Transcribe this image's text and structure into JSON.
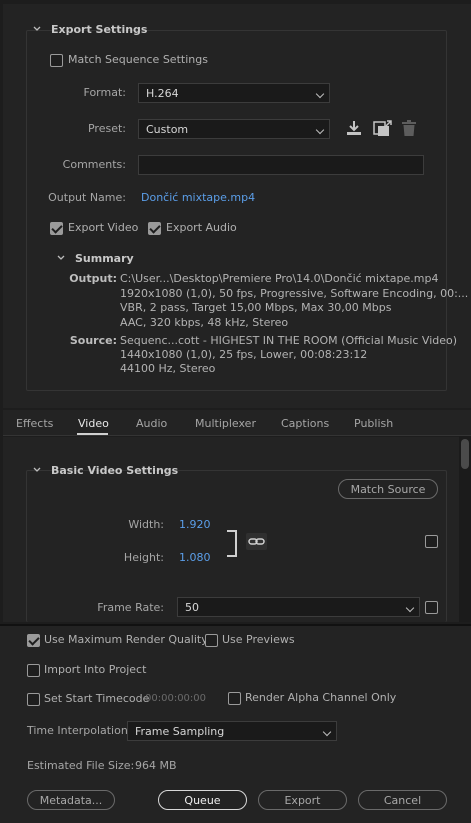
{
  "export_settings": {
    "header": "Export Settings",
    "match_sequence": {
      "label": "Match Sequence Settings",
      "checked": false
    },
    "format": {
      "label": "Format:",
      "value": "H.264"
    },
    "preset": {
      "label": "Preset:",
      "value": "Custom"
    },
    "comments": {
      "label": "Comments:",
      "value": ""
    },
    "output_name": {
      "label": "Output Name:",
      "value": "Dončić mixtape.mp4"
    },
    "export_video": {
      "label": "Export Video",
      "checked": true
    },
    "export_audio": {
      "label": "Export Audio",
      "checked": true
    },
    "summary": {
      "header": "Summary",
      "output_key": "Output:",
      "output_lines": [
        "C:\\User...\\Desktop\\Premiere Pro\\14.0\\Dončić mixtape.mp4",
        "1920x1080 (1,0), 50 fps, Progressive, Software Encoding, 00:...",
        "VBR, 2 pass, Target 15,00 Mbps, Max 30,00 Mbps",
        "AAC, 320 kbps, 48 kHz, Stereo"
      ],
      "source_key": "Source:",
      "source_lines": [
        "Sequenc...cott - HIGHEST IN THE ROOM (Official Music Video)",
        "1440x1080 (1,0), 25 fps, Lower, 00:08:23:12",
        "44100 Hz, Stereo"
      ]
    }
  },
  "tabs": [
    {
      "label": "Effects",
      "active": false
    },
    {
      "label": "Video",
      "active": true
    },
    {
      "label": "Audio",
      "active": false
    },
    {
      "label": "Multiplexer",
      "active": false
    },
    {
      "label": "Captions",
      "active": false
    },
    {
      "label": "Publish",
      "active": false
    }
  ],
  "video": {
    "header": "Basic Video Settings",
    "match_source_label": "Match Source",
    "width": {
      "label": "Width:",
      "value": "1.920"
    },
    "height": {
      "label": "Height:",
      "value": "1.080"
    },
    "frame_rate": {
      "label": "Frame Rate:",
      "value": "50"
    }
  },
  "bottom": {
    "use_max_render_quality": {
      "label": "Use Maximum Render Quality",
      "checked": true
    },
    "use_previews": {
      "label": "Use Previews",
      "checked": false
    },
    "import_into_project": {
      "label": "Import Into Project",
      "checked": false
    },
    "set_start_timecode": {
      "label": "Set Start Timecode",
      "checked": false,
      "timecode": "00:00:00:00"
    },
    "render_alpha": {
      "label": "Render Alpha Channel Only",
      "checked": false
    },
    "time_interpolation": {
      "label": "Time Interpolation:",
      "value": "Frame Sampling"
    },
    "estimated_file_size": {
      "label": "Estimated File Size:",
      "value": "964 MB"
    },
    "buttons": {
      "metadata": "Metadata...",
      "queue": "Queue",
      "export": "Export",
      "cancel": "Cancel"
    }
  },
  "icons": {
    "save_preset": "download-icon",
    "import_preset": "import-preset-icon",
    "delete_preset": "trash-icon",
    "link": "chain-link-icon"
  },
  "colors": {
    "accent_blue": "#5b9ee8",
    "panel": "#232323",
    "background": "#1d1d1d"
  }
}
